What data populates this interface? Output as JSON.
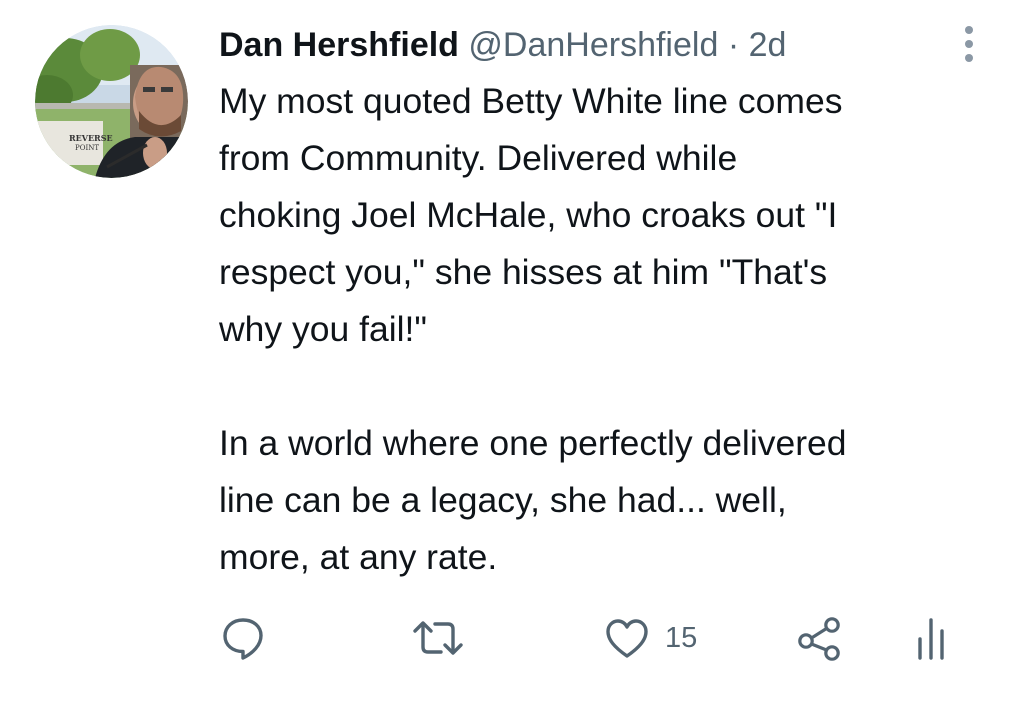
{
  "tweet": {
    "author_name": "Dan Hershfield",
    "handle": "@DanHershfield",
    "separator": "·",
    "time": "2d",
    "avatar_sign_text": [
      "REVERSE",
      "POINT"
    ],
    "paragraphs": [
      {
        "lines": [
          "My most quoted Betty White line comes",
          "from Community. Delivered while",
          "choking Joel McHale, who croaks out \"I",
          "respect you,\" she hisses at him \"That's",
          "why you fail!\""
        ]
      },
      {
        "lines": [
          "In a world where one perfectly delivered",
          "line can be a legacy, she had... well,",
          "more, at any rate."
        ]
      }
    ],
    "actions": {
      "reply_icon": "reply-icon",
      "retweet_icon": "retweet-icon",
      "like_icon": "heart-icon",
      "like_count": "15",
      "share_icon": "share-icon",
      "analytics_icon": "analytics-icon"
    }
  },
  "colors": {
    "text": "#0f1419",
    "secondary": "#536471",
    "icon": "#536471",
    "background": "#ffffff"
  }
}
